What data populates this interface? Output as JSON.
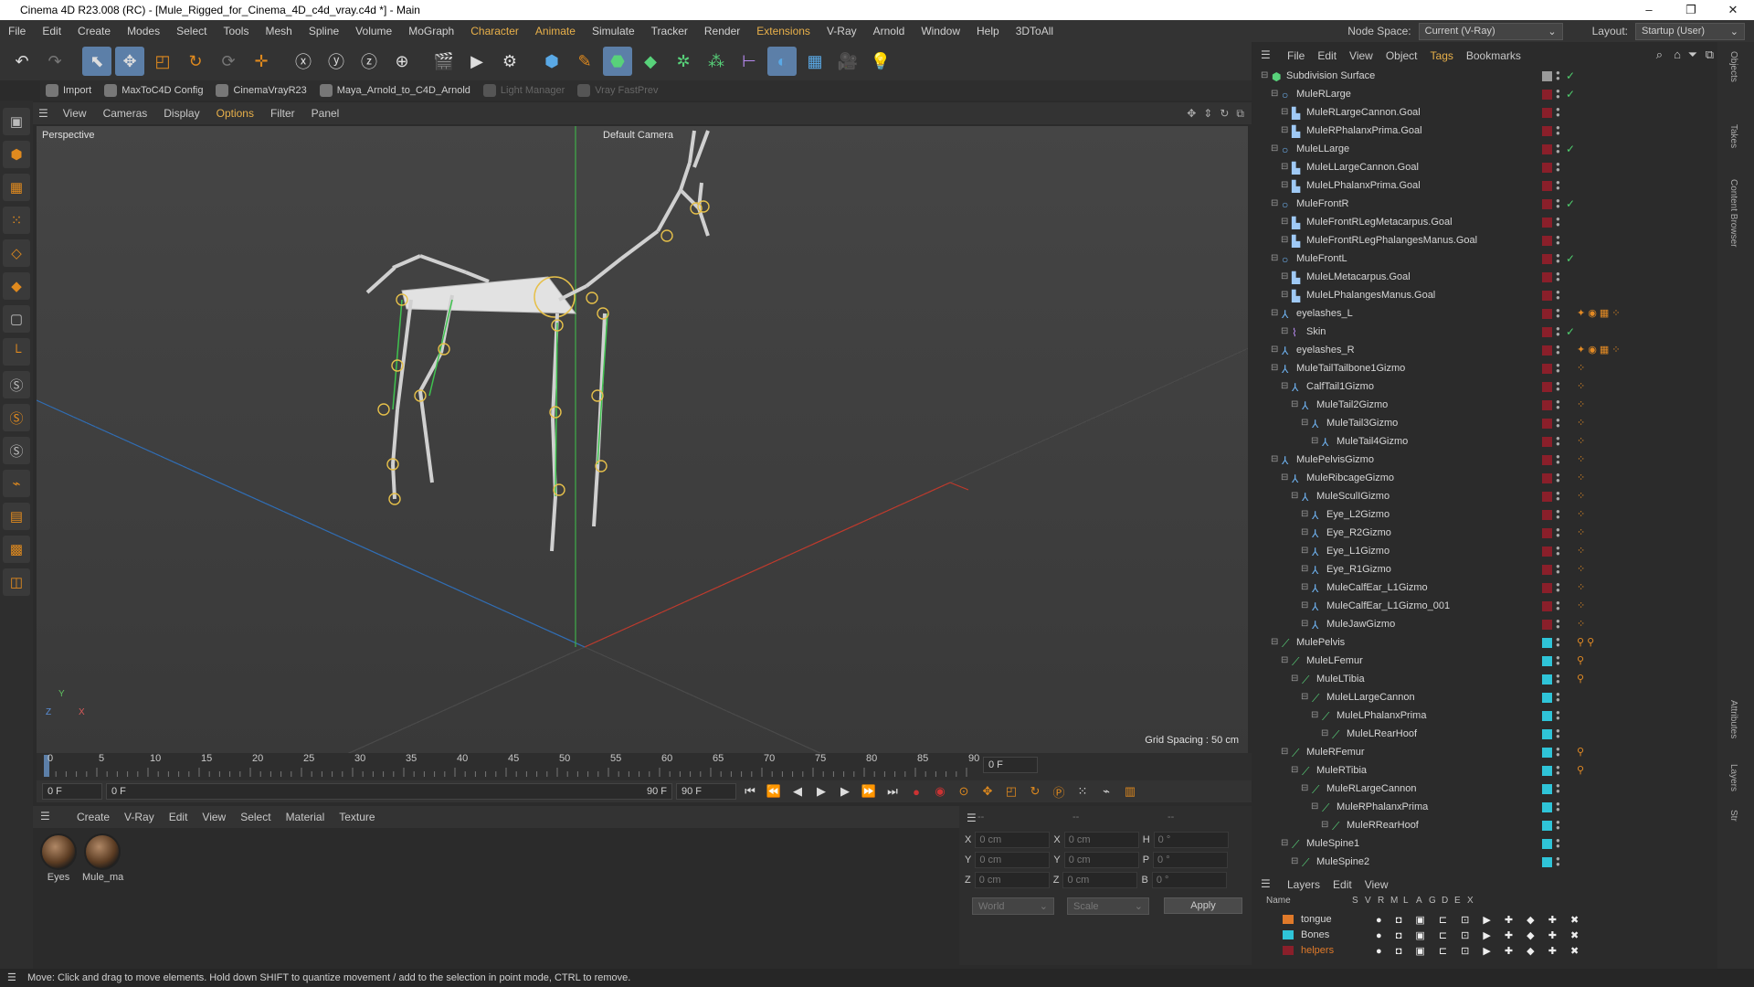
{
  "window": {
    "title": "Cinema 4D R23.008 (RC) - [Mule_Rigged_for_Cinema_4D_c4d_vray.c4d *] - Main",
    "controls": [
      "–",
      "❐",
      "✕"
    ]
  },
  "menubar": {
    "items": [
      "File",
      "Edit",
      "Create",
      "Modes",
      "Select",
      "Tools",
      "Mesh",
      "Spline",
      "Volume",
      "MoGraph",
      "Character",
      "Animate",
      "Simulate",
      "Tracker",
      "Render",
      "Extensions",
      "V-Ray",
      "Arnold",
      "Window",
      "Help",
      "3DToAll"
    ],
    "node_space_label": "Node Space:",
    "node_space_value": "Current (V-Ray)",
    "layout_label": "Layout:",
    "layout_value": "Startup (User)"
  },
  "pluginbar": {
    "items": [
      "Import",
      "MaxToC4D Config",
      "CinemaVrayR23",
      "Maya_Arnold_to_C4D_Arnold",
      "Light Manager",
      "Vray FastPrev"
    ]
  },
  "viewport": {
    "menu": [
      "View",
      "Cameras",
      "Display",
      "Options",
      "Filter",
      "Panel"
    ],
    "view_name": "Perspective",
    "camera": "Default Camera",
    "grid_spacing": "Grid Spacing : 50 cm",
    "axis_y": "Y",
    "axis_z": "Z",
    "axis_x": "X"
  },
  "timeline": {
    "ticks": [
      "0",
      "5",
      "10",
      "15",
      "20",
      "25",
      "30",
      "35",
      "40",
      "45",
      "50",
      "55",
      "60",
      "65",
      "70",
      "75",
      "80",
      "85",
      "90"
    ],
    "frame_box": "0 F",
    "start": "0 F",
    "current": "0 F",
    "end": "90 F",
    "end2": "90 F"
  },
  "materials": {
    "menu": [
      "Create",
      "V-Ray",
      "Edit",
      "View",
      "Select",
      "Material",
      "Texture"
    ],
    "items": [
      "Eyes",
      "Mule_ma"
    ]
  },
  "attributes": {
    "header": [
      "--",
      "--",
      "--"
    ],
    "x": {
      "label": "X",
      "value": "0 cm"
    },
    "y": {
      "label": "Y",
      "value": "0 cm"
    },
    "z": {
      "label": "Z",
      "value": "0 cm"
    },
    "x2": {
      "label": "X",
      "value": "0 cm"
    },
    "y2": {
      "label": "Y",
      "value": "0 cm"
    },
    "z2": {
      "label": "Z",
      "value": "0 cm"
    },
    "h": {
      "label": "H",
      "value": "0 °"
    },
    "p": {
      "label": "P",
      "value": "0 °"
    },
    "b": {
      "label": "B",
      "value": "0 °"
    },
    "coord": "World",
    "mode": "Scale",
    "apply": "Apply"
  },
  "object_manager": {
    "menu": [
      "File",
      "Edit",
      "View",
      "Object",
      "Tags",
      "Bookmarks"
    ],
    "objects": [
      {
        "name": "Subdivision Surface",
        "indent": 0,
        "icon": "gen",
        "layer": "#9a9a9a",
        "check": true,
        "tags": ""
      },
      {
        "name": "MuleRLarge",
        "indent": 1,
        "icon": "null",
        "layer": "#8a1f2a",
        "check": true,
        "tags": ""
      },
      {
        "name": "MuleRLargeCannon.Goal",
        "indent": 2,
        "icon": "goal",
        "layer": "#8a1f2a",
        "check": false,
        "tags": ""
      },
      {
        "name": "MuleRPhalanxPrima.Goal",
        "indent": 2,
        "icon": "goal",
        "layer": "#8a1f2a",
        "check": false,
        "tags": ""
      },
      {
        "name": "MuleLLarge",
        "indent": 1,
        "icon": "null",
        "layer": "#8a1f2a",
        "check": true,
        "tags": ""
      },
      {
        "name": "MuleLLargeCannon.Goal",
        "indent": 2,
        "icon": "goal",
        "layer": "#8a1f2a",
        "check": false,
        "tags": ""
      },
      {
        "name": "MuleLPhalanxPrima.Goal",
        "indent": 2,
        "icon": "goal",
        "layer": "#8a1f2a",
        "check": false,
        "tags": ""
      },
      {
        "name": "MuleFrontR",
        "indent": 1,
        "icon": "null",
        "layer": "#8a1f2a",
        "check": true,
        "tags": ""
      },
      {
        "name": "MuleFrontRLegMetacarpus.Goal",
        "indent": 2,
        "icon": "goal",
        "layer": "#8a1f2a",
        "check": false,
        "tags": ""
      },
      {
        "name": "MuleFrontRLegPhalangesManus.Goal",
        "indent": 2,
        "icon": "goal",
        "layer": "#8a1f2a",
        "check": false,
        "tags": ""
      },
      {
        "name": "MuleFrontL",
        "indent": 1,
        "icon": "null",
        "layer": "#8a1f2a",
        "check": true,
        "tags": ""
      },
      {
        "name": "MuleLMetacarpus.Goal",
        "indent": 2,
        "icon": "goal",
        "layer": "#8a1f2a",
        "check": false,
        "tags": ""
      },
      {
        "name": "MuleLPhalangesManus.Goal",
        "indent": 2,
        "icon": "goal",
        "layer": "#8a1f2a",
        "check": false,
        "tags": ""
      },
      {
        "name": "eyelashes_L",
        "indent": 1,
        "icon": "obj",
        "layer": "#8a1f2a",
        "check": false,
        "tags": "✦ ◉ ▦ ⁘"
      },
      {
        "name": "Skin",
        "indent": 2,
        "icon": "skin",
        "layer": "#8a1f2a",
        "check": true,
        "tags": ""
      },
      {
        "name": "eyelashes_R",
        "indent": 1,
        "icon": "obj",
        "layer": "#8a1f2a",
        "check": false,
        "tags": "✦ ◉ ▦ ⁘"
      },
      {
        "name": "MuleTailTailbone1Gizmo",
        "indent": 1,
        "icon": "obj",
        "layer": "#8a1f2a",
        "check": false,
        "tags": "⁘"
      },
      {
        "name": "CalfTail1Gizmo",
        "indent": 2,
        "icon": "obj",
        "layer": "#8a1f2a",
        "check": false,
        "tags": "⁘"
      },
      {
        "name": "MuleTail2Gizmo",
        "indent": 3,
        "icon": "obj",
        "layer": "#8a1f2a",
        "check": false,
        "tags": "⁘"
      },
      {
        "name": "MuleTail3Gizmo",
        "indent": 4,
        "icon": "obj",
        "layer": "#8a1f2a",
        "check": false,
        "tags": "⁘"
      },
      {
        "name": "MuleTail4Gizmo",
        "indent": 5,
        "icon": "obj",
        "layer": "#8a1f2a",
        "check": false,
        "tags": "⁘"
      },
      {
        "name": "MulePelvisGizmo",
        "indent": 1,
        "icon": "obj",
        "layer": "#8a1f2a",
        "check": false,
        "tags": "⁘"
      },
      {
        "name": "MuleRibcageGizmo",
        "indent": 2,
        "icon": "obj",
        "layer": "#8a1f2a",
        "check": false,
        "tags": "⁘"
      },
      {
        "name": "MuleSculIGizmo",
        "indent": 3,
        "icon": "obj",
        "layer": "#8a1f2a",
        "check": false,
        "tags": "⁘"
      },
      {
        "name": "Eye_L2Gizmo",
        "indent": 4,
        "icon": "obj",
        "layer": "#8a1f2a",
        "check": false,
        "tags": "⁘"
      },
      {
        "name": "Eye_R2Gizmo",
        "indent": 4,
        "icon": "obj",
        "layer": "#8a1f2a",
        "check": false,
        "tags": "⁘"
      },
      {
        "name": "Eye_L1Gizmo",
        "indent": 4,
        "icon": "obj",
        "layer": "#8a1f2a",
        "check": false,
        "tags": "⁘"
      },
      {
        "name": "Eye_R1Gizmo",
        "indent": 4,
        "icon": "obj",
        "layer": "#8a1f2a",
        "check": false,
        "tags": "⁘"
      },
      {
        "name": "MuleCalfEar_L1Gizmo",
        "indent": 4,
        "icon": "obj",
        "layer": "#8a1f2a",
        "check": false,
        "tags": "⁘"
      },
      {
        "name": "MuleCalfEar_L1Gizmo_001",
        "indent": 4,
        "icon": "obj",
        "layer": "#8a1f2a",
        "check": false,
        "tags": "⁘"
      },
      {
        "name": "MuleJawGizmo",
        "indent": 4,
        "icon": "obj",
        "layer": "#8a1f2a",
        "check": false,
        "tags": "⁘"
      },
      {
        "name": "MulePelvis",
        "indent": 1,
        "icon": "bone",
        "layer": "#2fc4d8",
        "check": false,
        "tags": "⚲ ⚲"
      },
      {
        "name": "MuleLFemur",
        "indent": 2,
        "icon": "bone",
        "layer": "#2fc4d8",
        "check": false,
        "tags": "⚲"
      },
      {
        "name": "MuleLTibia",
        "indent": 3,
        "icon": "bone",
        "layer": "#2fc4d8",
        "check": false,
        "tags": "⚲"
      },
      {
        "name": "MuleLLargeCannon",
        "indent": 4,
        "icon": "bone",
        "layer": "#2fc4d8",
        "check": false,
        "tags": ""
      },
      {
        "name": "MuleLPhalanxPrima",
        "indent": 5,
        "icon": "bone",
        "layer": "#2fc4d8",
        "check": false,
        "tags": ""
      },
      {
        "name": "MuleLRearHoof",
        "indent": 6,
        "icon": "bone",
        "layer": "#2fc4d8",
        "check": false,
        "tags": ""
      },
      {
        "name": "MuleRFemur",
        "indent": 2,
        "icon": "bone",
        "layer": "#2fc4d8",
        "check": false,
        "tags": "⚲"
      },
      {
        "name": "MuleRTibia",
        "indent": 3,
        "icon": "bone",
        "layer": "#2fc4d8",
        "check": false,
        "tags": "⚲"
      },
      {
        "name": "MuleRLargeCannon",
        "indent": 4,
        "icon": "bone",
        "layer": "#2fc4d8",
        "check": false,
        "tags": ""
      },
      {
        "name": "MuleRPhalanxPrima",
        "indent": 5,
        "icon": "bone",
        "layer": "#2fc4d8",
        "check": false,
        "tags": ""
      },
      {
        "name": "MuleRRearHoof",
        "indent": 6,
        "icon": "bone",
        "layer": "#2fc4d8",
        "check": false,
        "tags": ""
      },
      {
        "name": "MuleSpine1",
        "indent": 2,
        "icon": "bone",
        "layer": "#2fc4d8",
        "check": false,
        "tags": ""
      },
      {
        "name": "MuleSpine2",
        "indent": 3,
        "icon": "bone",
        "layer": "#2fc4d8",
        "check": false,
        "tags": ""
      }
    ]
  },
  "layers": {
    "menu": [
      "Layers",
      "Edit",
      "View"
    ],
    "headers": [
      "Name",
      "S",
      "V",
      "R",
      "M",
      "L",
      "A",
      "G",
      "D",
      "E",
      "X"
    ],
    "items": [
      {
        "name": "tongue",
        "color": "#e07a2a",
        "text_color": "#d6d6d6"
      },
      {
        "name": "Bones",
        "color": "#2fc4d8",
        "text_color": "#d6d6d6"
      },
      {
        "name": "helpers",
        "color": "#8a1f2a",
        "text_color": "#e07a2a"
      }
    ]
  },
  "right_tabs": [
    "Objects",
    "Takes",
    "Content Browser",
    "Attributes",
    "Layers",
    "Str"
  ],
  "status": "Move: Click and drag to move elements. Hold down SHIFT to quantize movement / add to the selection in point mode, CTRL to remove."
}
